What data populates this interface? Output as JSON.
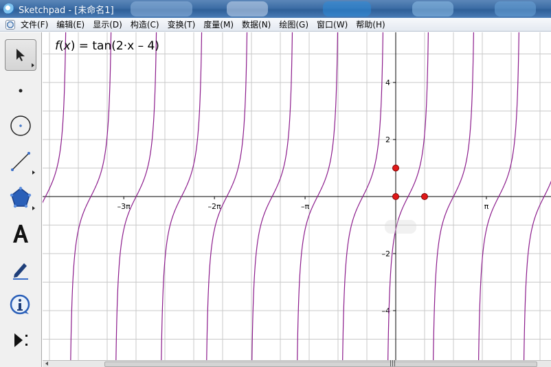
{
  "window": {
    "title": "Sketchpad - [未命名1]"
  },
  "menu": [
    "文件(F)",
    "编辑(E)",
    "显示(D)",
    "构造(C)",
    "变换(T)",
    "度量(M)",
    "数据(N)",
    "绘图(G)",
    "窗口(W)",
    "帮助(H)"
  ],
  "tools": [
    {
      "name": "arrow-select-tool",
      "icon": "arrow-icon",
      "selected": true
    },
    {
      "name": "point-tool",
      "icon": "point-icon"
    },
    {
      "name": "compass-tool",
      "icon": "compass-icon"
    },
    {
      "name": "straightedge-tool",
      "icon": "segment-icon"
    },
    {
      "name": "polygon-tool",
      "icon": "polygon-icon"
    },
    {
      "name": "text-tool",
      "icon": "text-A-icon"
    },
    {
      "name": "marker-tool",
      "icon": "marker-icon"
    },
    {
      "name": "information-tool",
      "icon": "info-icon"
    },
    {
      "name": "custom-tool",
      "icon": "custom-tool-icon"
    }
  ],
  "function_label": {
    "f": "f",
    "x": "x",
    "rest": " = tan(2·x – 4)"
  },
  "axes": {
    "x_ticks": [
      "–3π",
      "–2π",
      "–π",
      "π"
    ],
    "y_ticks": [
      "4",
      "2",
      "–2",
      "–4"
    ]
  },
  "colors": {
    "curve": "#8b1a8b",
    "grid": "#c8c8c8",
    "point": "#e01818"
  }
}
